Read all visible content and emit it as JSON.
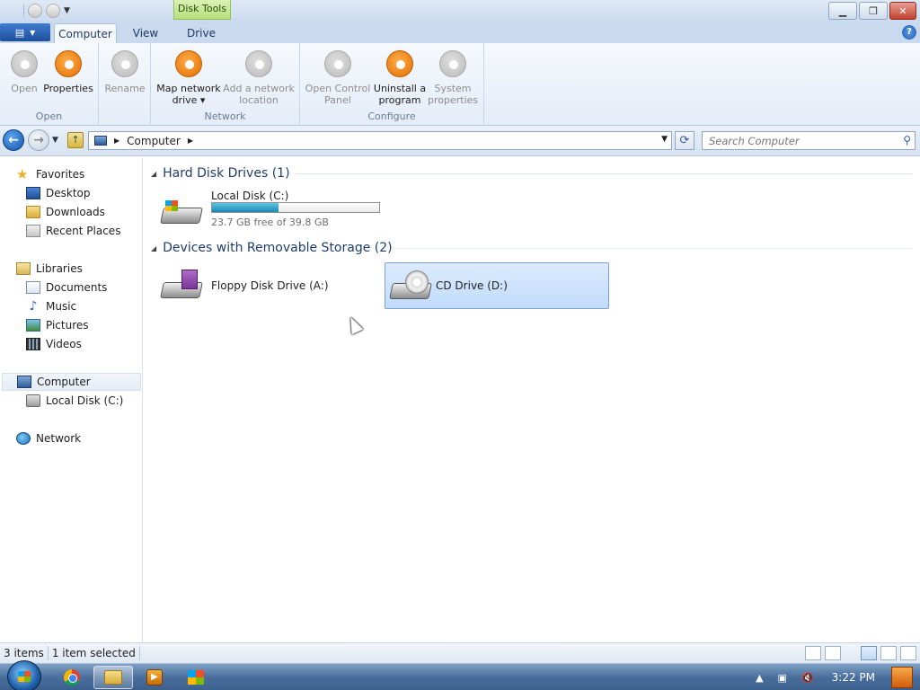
{
  "titlebar": {
    "contextual_tab": "Disk Tools",
    "window_buttons": [
      "minimize",
      "restore",
      "close"
    ],
    "close_glyph": "✕",
    "restore_glyph": "❐",
    "minimize_glyph": "▁"
  },
  "ribbon": {
    "tabs": [
      {
        "label": "Computer",
        "active": true
      },
      {
        "label": "View",
        "active": false
      },
      {
        "label": "Drive",
        "active": false
      }
    ],
    "help_glyph": "?",
    "groups": [
      {
        "label": "Open",
        "buttons": [
          {
            "label_line1": "Open",
            "label_line2": "",
            "enabled": false
          },
          {
            "label_line1": "Properties",
            "label_line2": "",
            "enabled": true
          }
        ]
      },
      {
        "label": "",
        "buttons": [
          {
            "label_line1": "Rename",
            "label_line2": "",
            "enabled": false
          }
        ]
      },
      {
        "label": "Network",
        "buttons": [
          {
            "label_line1": "Map network",
            "label_line2": "drive ▾",
            "enabled": true
          },
          {
            "label_line1": "Add a network",
            "label_line2": "location",
            "enabled": false
          }
        ]
      },
      {
        "label": "Configure",
        "buttons": [
          {
            "label_line1": "Open Control",
            "label_line2": "Panel",
            "enabled": false
          },
          {
            "label_line1": "Uninstall a",
            "label_line2": "program",
            "enabled": true
          },
          {
            "label_line1": "System",
            "label_line2": "properties",
            "enabled": false
          }
        ]
      }
    ]
  },
  "address_bar": {
    "breadcrumb": "Computer",
    "search_placeholder": "Search Computer"
  },
  "nav_pane": {
    "favorites": {
      "label": "Favorites",
      "items": [
        "Desktop",
        "Downloads",
        "Recent Places"
      ]
    },
    "libraries": {
      "label": "Libraries",
      "items": [
        "Documents",
        "Music",
        "Pictures",
        "Videos"
      ]
    },
    "computer": {
      "label": "Computer",
      "items": [
        "Local Disk (C:)"
      ]
    },
    "network": {
      "label": "Network"
    }
  },
  "content": {
    "sections": [
      {
        "title": "Hard Disk Drives (1)",
        "drives": [
          {
            "name": "Local Disk (C:)",
            "free_text": "23.7 GB free of 39.8 GB",
            "used_fraction": 0.4
          }
        ]
      },
      {
        "title": "Devices with Removable Storage (2)",
        "drives": [
          {
            "name": "Floppy Disk Drive (A:)"
          },
          {
            "name": "CD Drive (D:)",
            "selected": true
          }
        ]
      }
    ]
  },
  "status_bar": {
    "item_count": "3 items",
    "selection": "1 item selected"
  },
  "taskbar": {
    "apps": [
      "chrome-icon",
      "explorer-icon",
      "media-player-icon",
      "windows-flag-icon"
    ],
    "clock": "3:22 PM"
  }
}
